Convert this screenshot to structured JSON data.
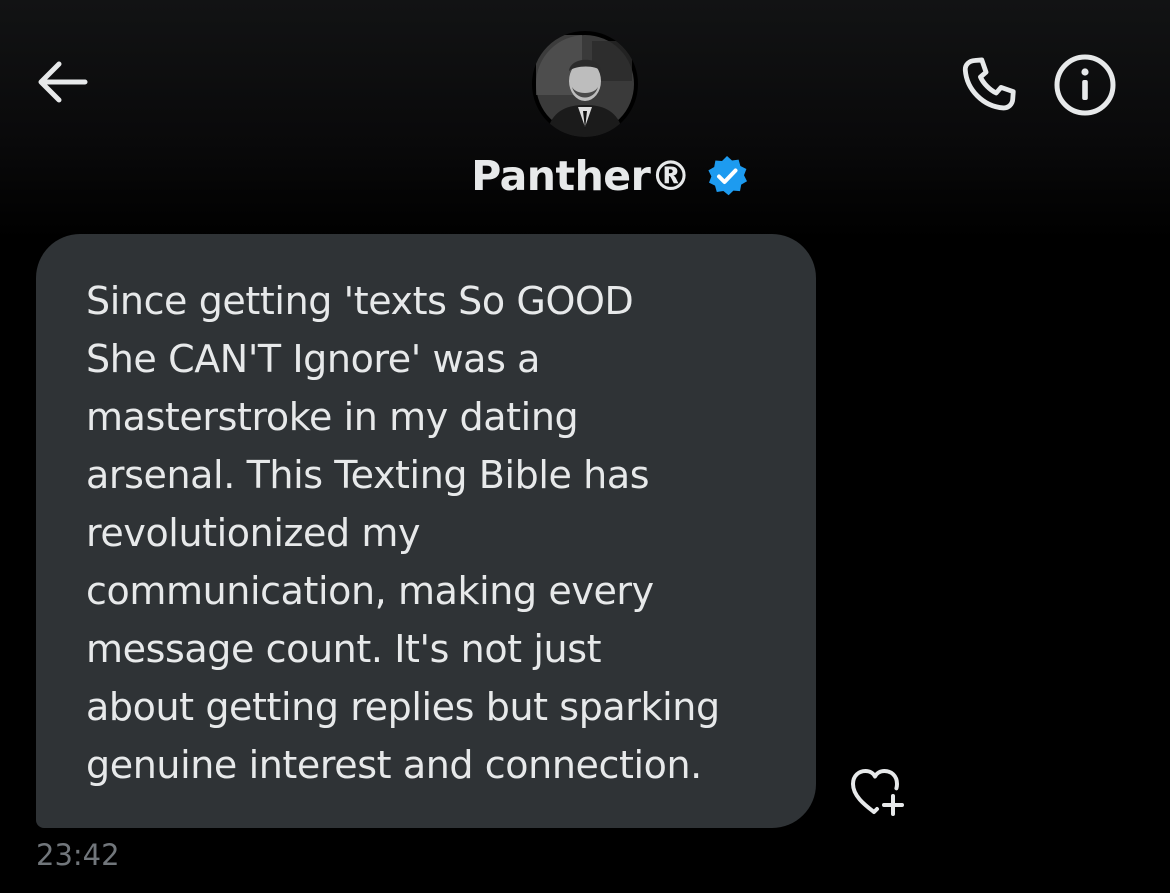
{
  "header": {
    "back_icon": "arrow-left-icon",
    "call_icon": "phone-icon",
    "info_icon": "info-circle-icon",
    "display_name": "Panther®",
    "verified_icon": "verified-badge-icon",
    "verified_color": "#1d9bf0"
  },
  "conversation": {
    "message": {
      "lines": [
        "Since getting 'texts So GOOD",
        "She CAN'T Ignore' was a",
        "masterstroke in my dating",
        "arsenal. This Texting Bible has",
        "revolutionized my",
        "communication, making every",
        "message count. It's not just",
        "about getting replies but sparking",
        "genuine interest and connection."
      ],
      "timestamp": "23:42",
      "react_icon": "heart-plus-icon"
    }
  },
  "colors": {
    "background": "#000000",
    "bubble": "#2f3336",
    "text": "#e7e9ea",
    "muted": "#71767b"
  }
}
